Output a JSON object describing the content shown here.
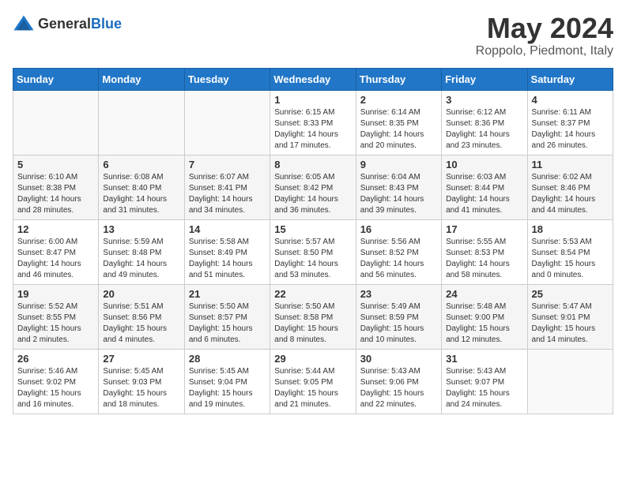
{
  "logo": {
    "general": "General",
    "blue": "Blue"
  },
  "header": {
    "month": "May 2024",
    "location": "Roppolo, Piedmont, Italy"
  },
  "days_of_week": [
    "Sunday",
    "Monday",
    "Tuesday",
    "Wednesday",
    "Thursday",
    "Friday",
    "Saturday"
  ],
  "weeks": [
    [
      {
        "day": "",
        "content": ""
      },
      {
        "day": "",
        "content": ""
      },
      {
        "day": "",
        "content": ""
      },
      {
        "day": "1",
        "content": "Sunrise: 6:15 AM\nSunset: 8:33 PM\nDaylight: 14 hours and 17 minutes."
      },
      {
        "day": "2",
        "content": "Sunrise: 6:14 AM\nSunset: 8:35 PM\nDaylight: 14 hours and 20 minutes."
      },
      {
        "day": "3",
        "content": "Sunrise: 6:12 AM\nSunset: 8:36 PM\nDaylight: 14 hours and 23 minutes."
      },
      {
        "day": "4",
        "content": "Sunrise: 6:11 AM\nSunset: 8:37 PM\nDaylight: 14 hours and 26 minutes."
      }
    ],
    [
      {
        "day": "5",
        "content": "Sunrise: 6:10 AM\nSunset: 8:38 PM\nDaylight: 14 hours and 28 minutes."
      },
      {
        "day": "6",
        "content": "Sunrise: 6:08 AM\nSunset: 8:40 PM\nDaylight: 14 hours and 31 minutes."
      },
      {
        "day": "7",
        "content": "Sunrise: 6:07 AM\nSunset: 8:41 PM\nDaylight: 14 hours and 34 minutes."
      },
      {
        "day": "8",
        "content": "Sunrise: 6:05 AM\nSunset: 8:42 PM\nDaylight: 14 hours and 36 minutes."
      },
      {
        "day": "9",
        "content": "Sunrise: 6:04 AM\nSunset: 8:43 PM\nDaylight: 14 hours and 39 minutes."
      },
      {
        "day": "10",
        "content": "Sunrise: 6:03 AM\nSunset: 8:44 PM\nDaylight: 14 hours and 41 minutes."
      },
      {
        "day": "11",
        "content": "Sunrise: 6:02 AM\nSunset: 8:46 PM\nDaylight: 14 hours and 44 minutes."
      }
    ],
    [
      {
        "day": "12",
        "content": "Sunrise: 6:00 AM\nSunset: 8:47 PM\nDaylight: 14 hours and 46 minutes."
      },
      {
        "day": "13",
        "content": "Sunrise: 5:59 AM\nSunset: 8:48 PM\nDaylight: 14 hours and 49 minutes."
      },
      {
        "day": "14",
        "content": "Sunrise: 5:58 AM\nSunset: 8:49 PM\nDaylight: 14 hours and 51 minutes."
      },
      {
        "day": "15",
        "content": "Sunrise: 5:57 AM\nSunset: 8:50 PM\nDaylight: 14 hours and 53 minutes."
      },
      {
        "day": "16",
        "content": "Sunrise: 5:56 AM\nSunset: 8:52 PM\nDaylight: 14 hours and 56 minutes."
      },
      {
        "day": "17",
        "content": "Sunrise: 5:55 AM\nSunset: 8:53 PM\nDaylight: 14 hours and 58 minutes."
      },
      {
        "day": "18",
        "content": "Sunrise: 5:53 AM\nSunset: 8:54 PM\nDaylight: 15 hours and 0 minutes."
      }
    ],
    [
      {
        "day": "19",
        "content": "Sunrise: 5:52 AM\nSunset: 8:55 PM\nDaylight: 15 hours and 2 minutes."
      },
      {
        "day": "20",
        "content": "Sunrise: 5:51 AM\nSunset: 8:56 PM\nDaylight: 15 hours and 4 minutes."
      },
      {
        "day": "21",
        "content": "Sunrise: 5:50 AM\nSunset: 8:57 PM\nDaylight: 15 hours and 6 minutes."
      },
      {
        "day": "22",
        "content": "Sunrise: 5:50 AM\nSunset: 8:58 PM\nDaylight: 15 hours and 8 minutes."
      },
      {
        "day": "23",
        "content": "Sunrise: 5:49 AM\nSunset: 8:59 PM\nDaylight: 15 hours and 10 minutes."
      },
      {
        "day": "24",
        "content": "Sunrise: 5:48 AM\nSunset: 9:00 PM\nDaylight: 15 hours and 12 minutes."
      },
      {
        "day": "25",
        "content": "Sunrise: 5:47 AM\nSunset: 9:01 PM\nDaylight: 15 hours and 14 minutes."
      }
    ],
    [
      {
        "day": "26",
        "content": "Sunrise: 5:46 AM\nSunset: 9:02 PM\nDaylight: 15 hours and 16 minutes."
      },
      {
        "day": "27",
        "content": "Sunrise: 5:45 AM\nSunset: 9:03 PM\nDaylight: 15 hours and 18 minutes."
      },
      {
        "day": "28",
        "content": "Sunrise: 5:45 AM\nSunset: 9:04 PM\nDaylight: 15 hours and 19 minutes."
      },
      {
        "day": "29",
        "content": "Sunrise: 5:44 AM\nSunset: 9:05 PM\nDaylight: 15 hours and 21 minutes."
      },
      {
        "day": "30",
        "content": "Sunrise: 5:43 AM\nSunset: 9:06 PM\nDaylight: 15 hours and 22 minutes."
      },
      {
        "day": "31",
        "content": "Sunrise: 5:43 AM\nSunset: 9:07 PM\nDaylight: 15 hours and 24 minutes."
      },
      {
        "day": "",
        "content": ""
      }
    ]
  ]
}
